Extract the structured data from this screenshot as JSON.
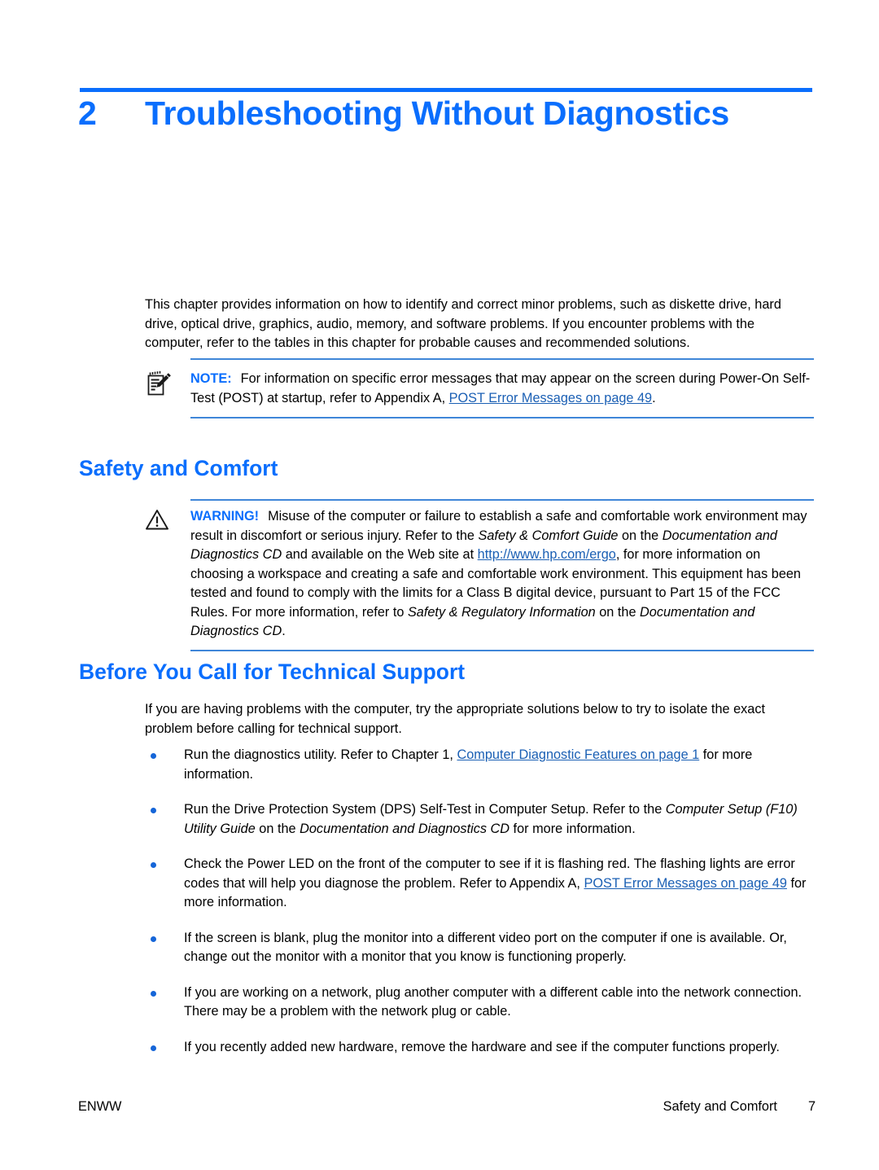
{
  "colors": {
    "accent_blue": "#0a6efd",
    "rule_blue": "#3f86d8",
    "link_blue": "#1a5fb4",
    "bullet_blue": "#1565d8",
    "text_black": "#000000"
  },
  "chapter": {
    "number": "2",
    "title": "Troubleshooting Without Diagnostics"
  },
  "intro": {
    "text": "This chapter provides information on how to identify and correct minor problems, such as diskette drive, hard drive, optical drive, graphics, audio, memory, and software problems. If you encounter problems with the computer, refer to the tables in this chapter for probable causes and recommended solutions."
  },
  "note": {
    "icon": "notepad-pencil-icon",
    "label": "NOTE:",
    "text_part1": "For information on specific error messages that may appear on the screen during Power-On Self-Test (POST) at startup, refer to Appendix A, ",
    "link": "POST Error Messages on page 49",
    "text_part2": "."
  },
  "sections": {
    "safety_and_comfort": "Safety and Comfort",
    "before_you_call": "Before You Call for Technical Support"
  },
  "warning": {
    "icon": "warning-triangle-icon",
    "label": "WARNING!",
    "t1": "Misuse of the computer or failure to establish a safe and comfortable work environment may result in discomfort or serious injury. Refer to the ",
    "i1": "Safety & Comfort Guide",
    "t2": " on the ",
    "i2": "Documentation and Diagnostics CD",
    "t3": " and available on the Web site at ",
    "link": "http://www.hp.com/ergo",
    "t4": ", for more information on choosing a workspace and creating a safe and comfortable work environment. This equipment has been tested and found to comply with the limits for a Class B digital device, pursuant to Part 15 of the FCC Rules. For more information, refer to ",
    "i3": "Safety & Regulatory Information",
    "t5": " on the ",
    "i4": "Documentation and Diagnostics CD",
    "t6": "."
  },
  "before_para": {
    "text": "If you are having problems with the computer, try the appropriate solutions below to try to isolate the exact problem before calling for technical support."
  },
  "bullets": [
    {
      "t1": "Run the diagnostics utility. Refer to Chapter 1, ",
      "link": "Computer Diagnostic Features on page 1",
      "t2": " for more information."
    },
    {
      "t1": "Run the Drive Protection System (DPS) Self-Test in Computer Setup. Refer to the ",
      "i1": "Computer Setup (F10) Utility Guide",
      "t2": " on the ",
      "i2": "Documentation and Diagnostics CD",
      "t3": " for more information."
    },
    {
      "t1": "Check the Power LED on the front of the computer to see if it is flashing red. The flashing lights are error codes that will help you diagnose the problem. Refer to Appendix A, ",
      "link": "POST Error Messages on page 49",
      "t2": " for more information."
    },
    {
      "t1": "If the screen is blank, plug the monitor into a different video port on the computer if one is available. Or, change out the monitor with a monitor that you know is functioning properly."
    },
    {
      "t1": "If you are working on a network, plug another computer with a different cable into the network connection. There may be a problem with the network plug or cable."
    },
    {
      "t1": "If you recently added new hardware, remove the hardware and see if the computer functions properly."
    }
  ],
  "footer": {
    "left": "ENWW",
    "right_label": "Safety and Comfort",
    "page_number": "7"
  }
}
